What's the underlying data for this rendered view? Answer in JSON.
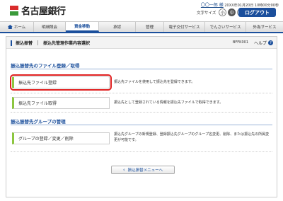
{
  "header": {
    "bank_name": "名古屋銀行",
    "user_name": "〇〇一郎 様",
    "last_login": "20XX年01月20日 10時00分00秒",
    "text_size_label": "文字サイズ",
    "text_sizes": [
      "小",
      "中",
      "大"
    ],
    "text_size_selected": "中",
    "logout_label": "ログアウト"
  },
  "nav": {
    "items": [
      {
        "label": "ホーム",
        "icon": "home-icon"
      },
      {
        "label": "明細照会"
      },
      {
        "label": "資金移動"
      },
      {
        "label": "承認"
      },
      {
        "label": "管理"
      },
      {
        "label": "電子交付サービス"
      },
      {
        "label": "でんさいサービス"
      },
      {
        "label": "外為サービス"
      }
    ],
    "active_index": 2
  },
  "page": {
    "category": "振込振替",
    "title": "振込先管理作業内容選択",
    "screen_id": "BFFK001",
    "help_label": "ヘルプ"
  },
  "sections": [
    {
      "heading": "振込振替先のファイル登録／取得",
      "items": [
        {
          "label": "振込先ファイル登録",
          "description": "振込先ファイルを使用して振込先を登録できます。",
          "highlighted": true
        },
        {
          "label": "振込先ファイル取得",
          "description": "振込先として登録されている情報を振込先ファイルで取得できます。",
          "highlighted": false
        }
      ]
    },
    {
      "heading": "振込振替先グループの管理",
      "items": [
        {
          "label": "グループの登録／変更／削除",
          "description": "振込先グループの新規登録、登録振込先グループのグループ名変更、削除、または振込先の所属変更が可能です。",
          "highlighted": false
        }
      ]
    }
  ],
  "back_button": {
    "label": "振込振替メニューへ"
  },
  "colors": {
    "brand_blue": "#1b4f9c",
    "accent_green": "#8cc63f",
    "highlight_red": "#e02020"
  }
}
